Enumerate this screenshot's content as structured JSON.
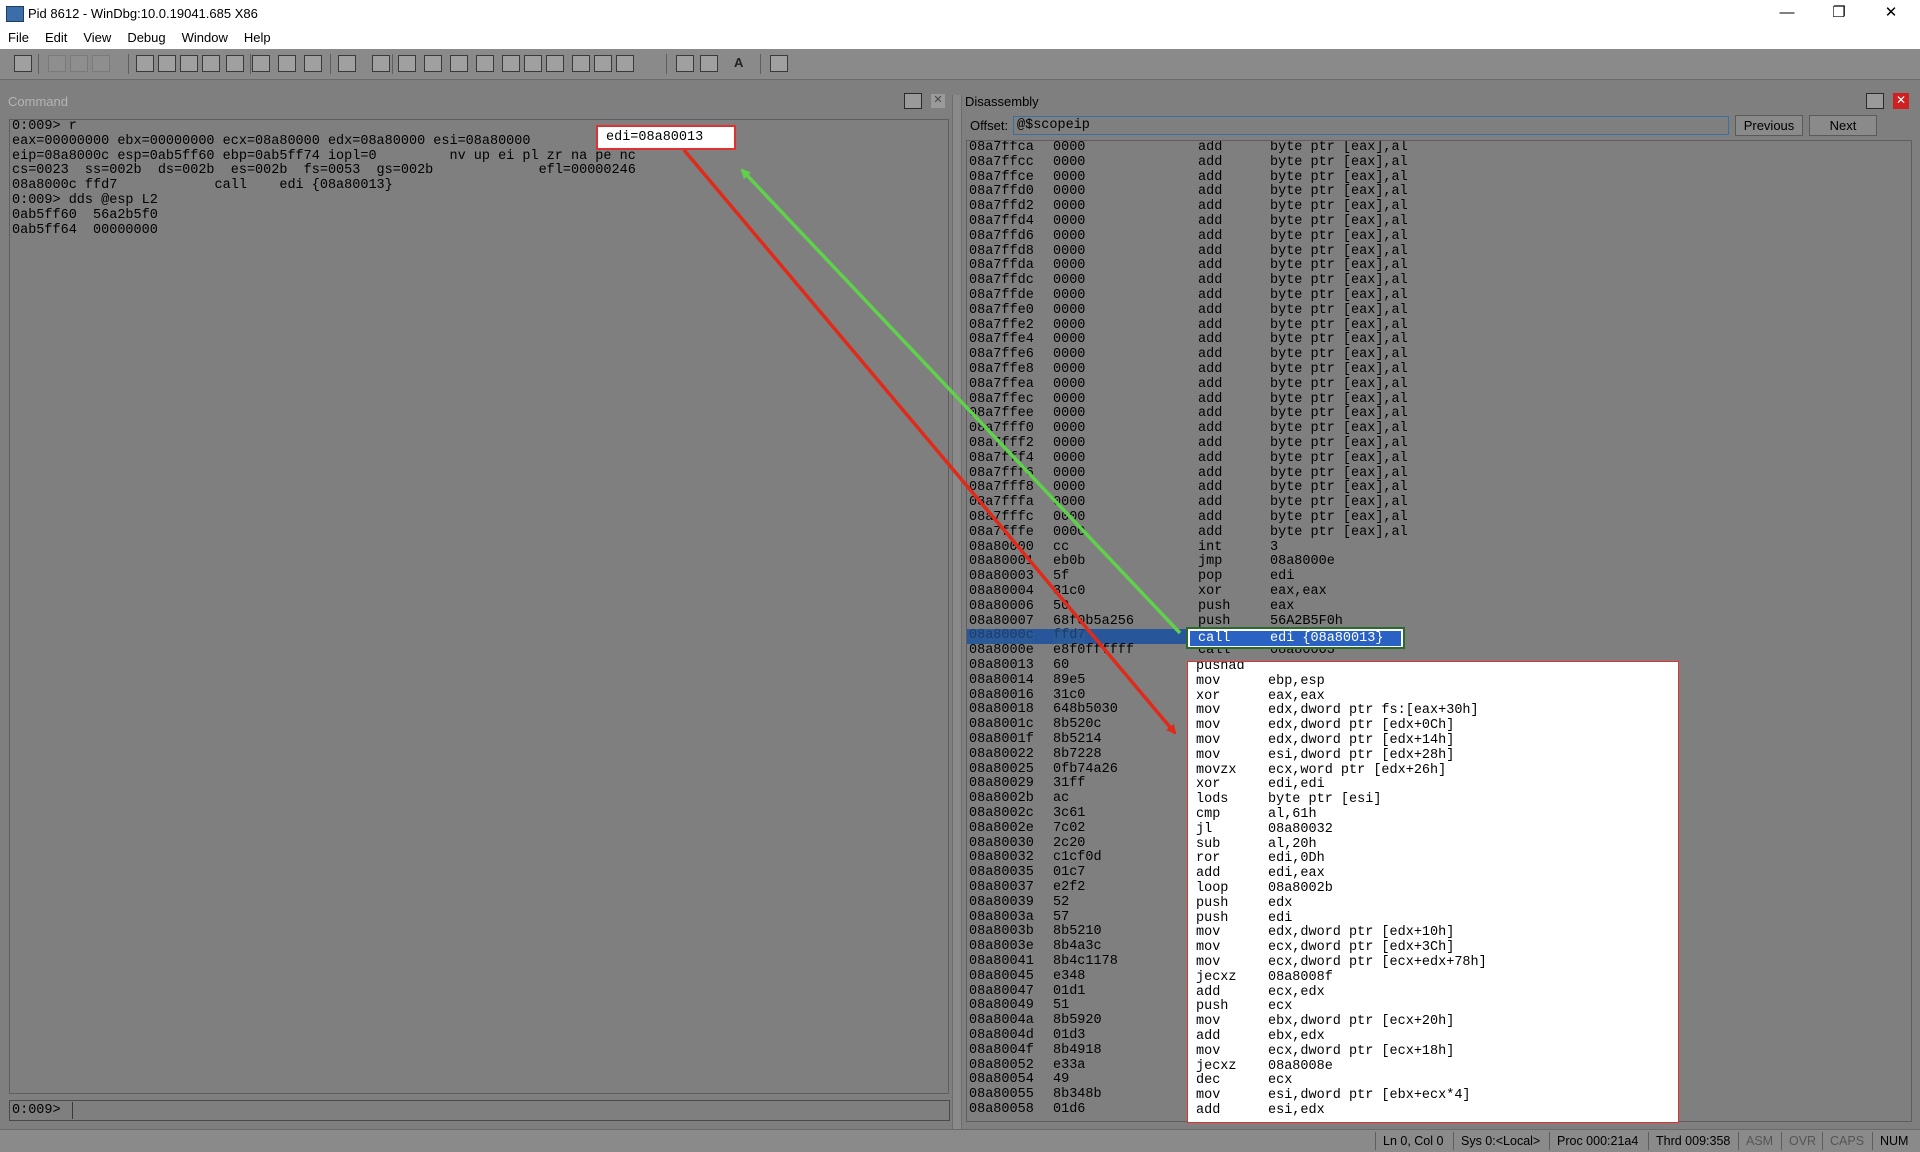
{
  "window": {
    "title": "Pid 8612 - WinDbg:10.0.19041.685 X86",
    "controls": {
      "minimize": "—",
      "restore": "❐",
      "close": "✕"
    }
  },
  "menu": [
    "File",
    "Edit",
    "View",
    "Debug",
    "Window",
    "Help"
  ],
  "toolbar": {
    "icons": [
      "open-icon",
      "cut-icon",
      "copy-icon",
      "paste-icon",
      "go-icon",
      "restart-icon",
      "stop-debugging-icon",
      "detach-icon",
      "break-icon",
      "step-into-icon",
      "step-over-icon",
      "step-out-icon",
      "run-to-cursor-icon",
      "source-mode-icon",
      "command-window-icon",
      "watch-window-icon",
      "locals-window-icon",
      "registers-window-icon",
      "memory-window-icon",
      "call-stack-icon",
      "disassembly-window-icon",
      "scratch-pad-icon",
      "processes-threads-icon",
      "source-mode-on-icon",
      "source-mode-off-icon",
      "font-icon",
      "options-icon"
    ],
    "font_label": "A"
  },
  "command": {
    "header": "Command",
    "lines": [
      "0:009> r",
      "eax=00000000 ebx=00000000 ecx=08a80000 edx=08a80000 esi=08a80000",
      "eip=08a8000c esp=0ab5ff60 ebp=0ab5ff74 iopl=0         nv up ei pl zr na pe nc",
      "cs=0023  ss=002b  ds=002b  es=002b  fs=0053  gs=002b             efl=00000246",
      "08a8000c ffd7            call    edi {08a80013}",
      "0:009> dds @esp L2",
      "0ab5ff60  56a2b5f0",
      "0ab5ff64  00000000"
    ],
    "highlight": "edi=08a80013",
    "prompt": "0:009>",
    "input_value": ""
  },
  "disassembly": {
    "header": "Disassembly",
    "offset_label": "Offset:",
    "offset_value": "@$scopeip",
    "previous_label": "Previous",
    "next_label": "Next",
    "rows": [
      [
        "08a7ffca",
        "0000",
        "add",
        "byte ptr [eax],al"
      ],
      [
        "08a7ffcc",
        "0000",
        "add",
        "byte ptr [eax],al"
      ],
      [
        "08a7ffce",
        "0000",
        "add",
        "byte ptr [eax],al"
      ],
      [
        "08a7ffd0",
        "0000",
        "add",
        "byte ptr [eax],al"
      ],
      [
        "08a7ffd2",
        "0000",
        "add",
        "byte ptr [eax],al"
      ],
      [
        "08a7ffd4",
        "0000",
        "add",
        "byte ptr [eax],al"
      ],
      [
        "08a7ffd6",
        "0000",
        "add",
        "byte ptr [eax],al"
      ],
      [
        "08a7ffd8",
        "0000",
        "add",
        "byte ptr [eax],al"
      ],
      [
        "08a7ffda",
        "0000",
        "add",
        "byte ptr [eax],al"
      ],
      [
        "08a7ffdc",
        "0000",
        "add",
        "byte ptr [eax],al"
      ],
      [
        "08a7ffde",
        "0000",
        "add",
        "byte ptr [eax],al"
      ],
      [
        "08a7ffe0",
        "0000",
        "add",
        "byte ptr [eax],al"
      ],
      [
        "08a7ffe2",
        "0000",
        "add",
        "byte ptr [eax],al"
      ],
      [
        "08a7ffe4",
        "0000",
        "add",
        "byte ptr [eax],al"
      ],
      [
        "08a7ffe6",
        "0000",
        "add",
        "byte ptr [eax],al"
      ],
      [
        "08a7ffe8",
        "0000",
        "add",
        "byte ptr [eax],al"
      ],
      [
        "08a7ffea",
        "0000",
        "add",
        "byte ptr [eax],al"
      ],
      [
        "08a7ffec",
        "0000",
        "add",
        "byte ptr [eax],al"
      ],
      [
        "08a7ffee",
        "0000",
        "add",
        "byte ptr [eax],al"
      ],
      [
        "08a7fff0",
        "0000",
        "add",
        "byte ptr [eax],al"
      ],
      [
        "08a7fff2",
        "0000",
        "add",
        "byte ptr [eax],al"
      ],
      [
        "08a7fff4",
        "0000",
        "add",
        "byte ptr [eax],al"
      ],
      [
        "08a7fff6",
        "0000",
        "add",
        "byte ptr [eax],al"
      ],
      [
        "08a7fff8",
        "0000",
        "add",
        "byte ptr [eax],al"
      ],
      [
        "08a7fffa",
        "0000",
        "add",
        "byte ptr [eax],al"
      ],
      [
        "08a7fffc",
        "0000",
        "add",
        "byte ptr [eax],al"
      ],
      [
        "08a7fffe",
        "0000",
        "add",
        "byte ptr [eax],al"
      ],
      [
        "08a80000",
        "cc",
        "int",
        "3"
      ],
      [
        "08a80001",
        "eb0b",
        "jmp",
        "08a8000e"
      ],
      [
        "08a80003",
        "5f",
        "pop",
        "edi"
      ],
      [
        "08a80004",
        "31c0",
        "xor",
        "eax,eax"
      ],
      [
        "08a80006",
        "50",
        "push",
        "eax"
      ],
      [
        "08a80007",
        "68f0b5a256",
        "push",
        "56A2B5F0h"
      ],
      [
        "08a8000c",
        "ffd7",
        "call",
        "edi {08a80013}"
      ],
      [
        "08a8000e",
        "e8f0ffffff",
        "call",
        "08a80003"
      ],
      [
        "08a80013",
        "60",
        "pushad",
        ""
      ],
      [
        "08a80014",
        "89e5",
        "mov",
        "ebp,esp"
      ],
      [
        "08a80016",
        "31c0",
        "xor",
        "eax,eax"
      ],
      [
        "08a80018",
        "648b5030",
        "mov",
        "edx,dword ptr fs:[eax+30h]"
      ],
      [
        "08a8001c",
        "8b520c",
        "mov",
        "edx,dword ptr [edx+0Ch]"
      ],
      [
        "08a8001f",
        "8b5214",
        "mov",
        "edx,dword ptr [edx+14h]"
      ],
      [
        "08a80022",
        "8b7228",
        "mov",
        "esi,dword ptr [edx+28h]"
      ],
      [
        "08a80025",
        "0fb74a26",
        "movzx",
        "ecx,word ptr [edx+26h]"
      ],
      [
        "08a80029",
        "31ff",
        "xor",
        "edi,edi"
      ],
      [
        "08a8002b",
        "ac",
        "lods",
        "byte ptr [esi]"
      ],
      [
        "08a8002c",
        "3c61",
        "cmp",
        "al,61h"
      ],
      [
        "08a8002e",
        "7c02",
        "jl",
        "08a80032"
      ],
      [
        "08a80030",
        "2c20",
        "sub",
        "al,20h"
      ],
      [
        "08a80032",
        "c1cf0d",
        "ror",
        "edi,0Dh"
      ],
      [
        "08a80035",
        "01c7",
        "add",
        "edi,eax"
      ],
      [
        "08a80037",
        "e2f2",
        "loop",
        "08a8002b"
      ],
      [
        "08a80039",
        "52",
        "push",
        "edx"
      ],
      [
        "08a8003a",
        "57",
        "push",
        "edi"
      ],
      [
        "08a8003b",
        "8b5210",
        "mov",
        "edx,dword ptr [edx+10h]"
      ],
      [
        "08a8003e",
        "8b4a3c",
        "mov",
        "ecx,dword ptr [edx+3Ch]"
      ],
      [
        "08a80041",
        "8b4c1178",
        "mov",
        "ecx,dword ptr [ecx+edx+78h]"
      ],
      [
        "08a80045",
        "e348",
        "jecxz",
        "08a8008f"
      ],
      [
        "08a80047",
        "01d1",
        "add",
        "ecx,edx"
      ],
      [
        "08a80049",
        "51",
        "push",
        "ecx"
      ],
      [
        "08a8004a",
        "8b5920",
        "mov",
        "ebx,dword ptr [ecx+20h]"
      ],
      [
        "08a8004d",
        "01d3",
        "add",
        "ebx,edx"
      ],
      [
        "08a8004f",
        "8b4918",
        "mov",
        "ecx,dword ptr [ecx+18h]"
      ],
      [
        "08a80052",
        "e33a",
        "jecxz",
        "08a8008e"
      ],
      [
        "08a80054",
        "49",
        "dec",
        "ecx"
      ],
      [
        "08a80055",
        "8b348b",
        "mov",
        "esi,dword ptr [ebx+ecx*4]"
      ],
      [
        "08a80058",
        "01d6",
        "add",
        "esi,edx"
      ]
    ],
    "current_row_index": 33,
    "popup_start_index": 35
  },
  "status": {
    "position": "Ln 0, Col 0",
    "sys": "Sys 0:<Local>",
    "proc": "Proc 000:21a4",
    "thrd": "Thrd 009:358",
    "asm": "ASM",
    "ovr": "OVR",
    "caps": "CAPS",
    "num": "NUM"
  },
  "colors": {
    "highlight_border": "#e03030",
    "current_line": "#2a62c4",
    "green_arrow": "#5fd14a",
    "red_arrow": "#e02a1a"
  }
}
